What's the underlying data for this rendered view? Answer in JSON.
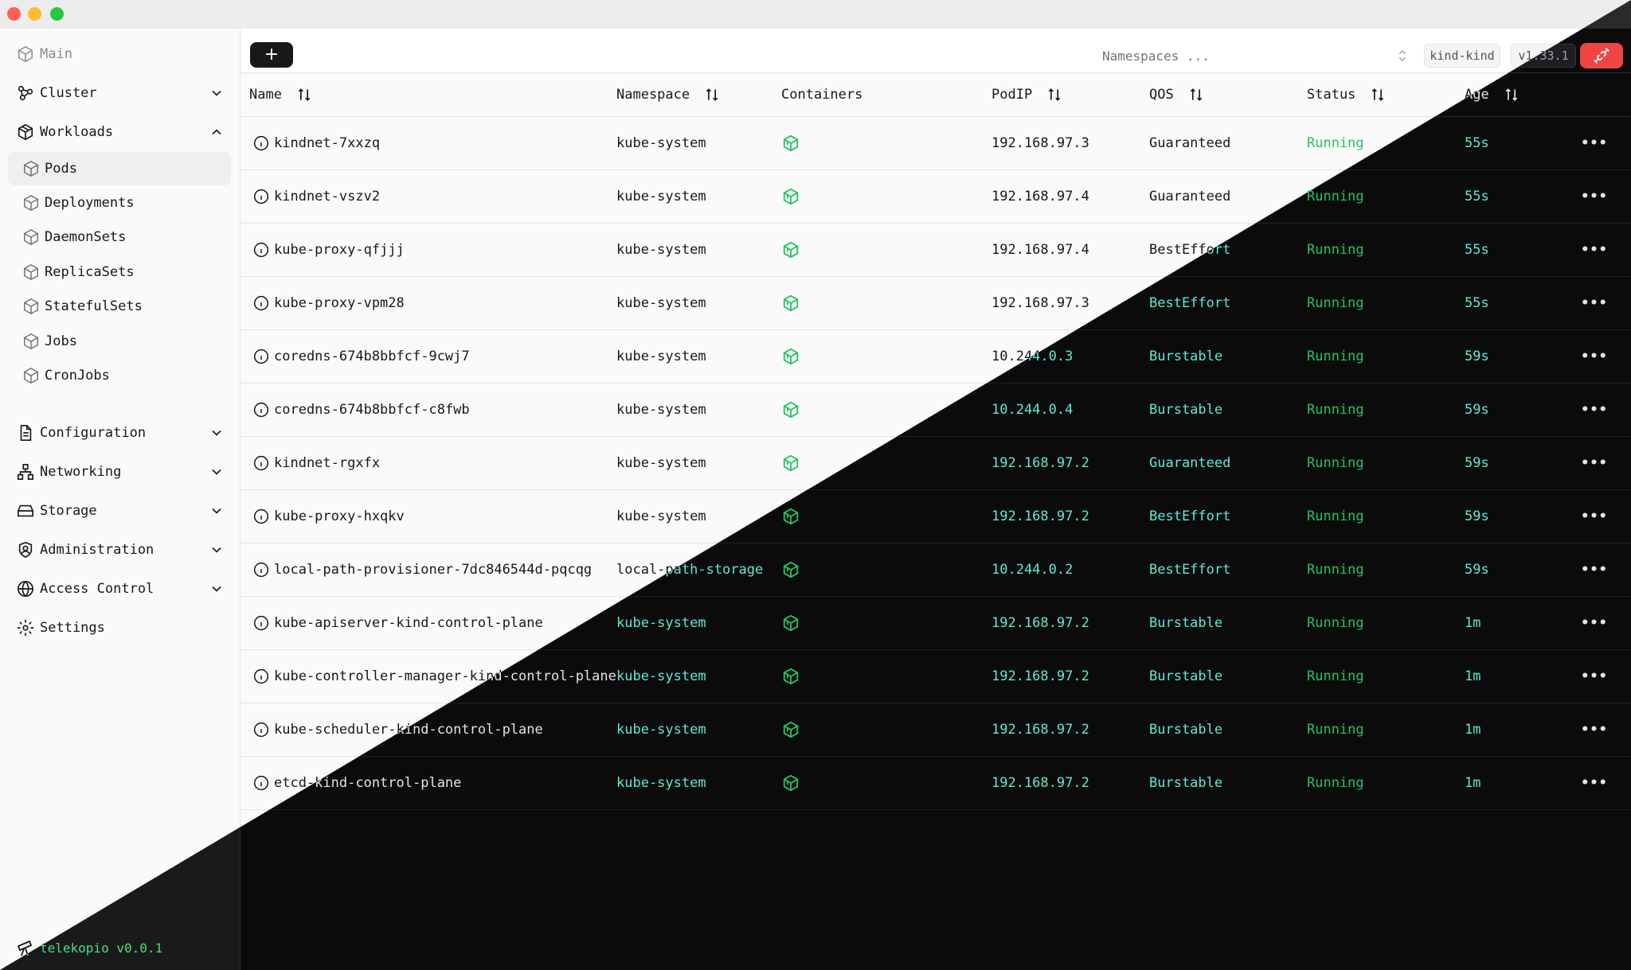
{
  "sidebar": {
    "main": "Main",
    "groups": [
      {
        "label": "Cluster",
        "icon": "cluster-icon"
      },
      {
        "label": "Workloads",
        "icon": "workloads-icon"
      },
      {
        "label": "Configuration",
        "icon": "configuration-icon"
      },
      {
        "label": "Networking",
        "icon": "networking-icon"
      },
      {
        "label": "Storage",
        "icon": "storage-icon"
      },
      {
        "label": "Administration",
        "icon": "administration-icon"
      },
      {
        "label": "Access Control",
        "icon": "access-control-icon"
      },
      {
        "label": "Settings",
        "icon": "settings-icon"
      }
    ],
    "workloads": [
      "Pods",
      "Deployments",
      "DaemonSets",
      "ReplicaSets",
      "StatefulSets",
      "Jobs",
      "CronJobs"
    ],
    "active": "Pods",
    "footer": "telekopio v0.0.1"
  },
  "toolbar": {
    "add_label": "+",
    "namespace_placeholder": "Namespaces ...",
    "context": "kind-kind",
    "version": "v1.33.1"
  },
  "table": {
    "columns": [
      "Name",
      "Namespace",
      "Containers",
      "PodIP",
      "QOS",
      "Status",
      "Age"
    ],
    "rows": [
      {
        "name": "kindnet-7xxzq",
        "namespace": "kube-system",
        "ip": "192.168.97.3",
        "qos": "Guaranteed",
        "status": "Running",
        "age": "55s"
      },
      {
        "name": "kindnet-vszv2",
        "namespace": "kube-system",
        "ip": "192.168.97.4",
        "qos": "Guaranteed",
        "status": "Running",
        "age": "55s"
      },
      {
        "name": "kube-proxy-qfjjj",
        "namespace": "kube-system",
        "ip": "192.168.97.4",
        "qos": "BestEffort",
        "status": "Running",
        "age": "55s"
      },
      {
        "name": "kube-proxy-vpm28",
        "namespace": "kube-system",
        "ip": "192.168.97.3",
        "qos": "BestEffort",
        "status": "Running",
        "age": "55s"
      },
      {
        "name": "coredns-674b8bbfcf-9cwj7",
        "namespace": "kube-system",
        "ip": "10.244.0.3",
        "qos": "Burstable",
        "status": "Running",
        "age": "59s"
      },
      {
        "name": "coredns-674b8bbfcf-c8fwb",
        "namespace": "kube-system",
        "ip": "10.244.0.4",
        "qos": "Burstable",
        "status": "Running",
        "age": "59s"
      },
      {
        "name": "kindnet-rgxfx",
        "namespace": "kube-system",
        "ip": "192.168.97.2",
        "qos": "Guaranteed",
        "status": "Running",
        "age": "59s"
      },
      {
        "name": "kube-proxy-hxqkv",
        "namespace": "kube-system",
        "ip": "192.168.97.2",
        "qos": "BestEffort",
        "status": "Running",
        "age": "59s"
      },
      {
        "name": "local-path-provisioner-7dc846544d-pqcqg",
        "namespace": "local-path-storage",
        "ip": "10.244.0.2",
        "qos": "BestEffort",
        "status": "Running",
        "age": "59s"
      },
      {
        "name": "kube-apiserver-kind-control-plane",
        "namespace": "kube-system",
        "ip": "192.168.97.2",
        "qos": "Burstable",
        "status": "Running",
        "age": "1m"
      },
      {
        "name": "kube-controller-manager-kind-control-plane",
        "namespace": "kube-system",
        "ip": "192.168.97.2",
        "qos": "Burstable",
        "status": "Running",
        "age": "1m"
      },
      {
        "name": "kube-scheduler-kind-control-plane",
        "namespace": "kube-system",
        "ip": "192.168.97.2",
        "qos": "Burstable",
        "status": "Running",
        "age": "1m"
      },
      {
        "name": "etcd-kind-control-plane",
        "namespace": "kube-system",
        "ip": "192.168.97.2",
        "qos": "Burstable",
        "status": "Running",
        "age": "1m"
      }
    ],
    "row_action_label": "•••"
  },
  "colors": {
    "running": "#22c55e",
    "connection_button": "#ef4444",
    "container_icon": "#22c55e"
  }
}
